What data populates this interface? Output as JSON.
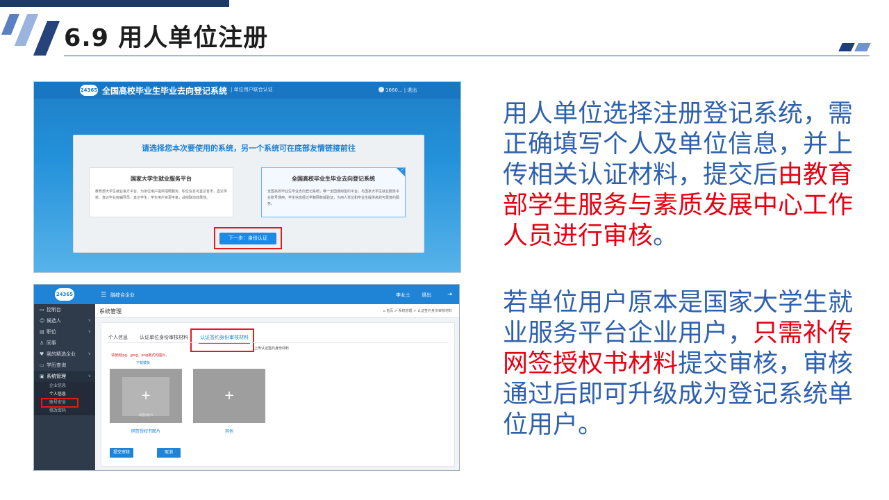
{
  "slide": {
    "title": "6.9 用人单位注册"
  },
  "screenshot1": {
    "logo": "24365",
    "system_name": "全国高校毕业生毕业去向登记系统",
    "header_sub": "| 单位用户联合认证",
    "user": "1660... | 退出",
    "prompt": "请选择您本次要使用的系统，另一个系统可在底部友情链接前往",
    "option1": {
      "title": "国家大学生就业服务平台",
      "desc": "教育部大学生就业官方平台，为单位用户提供招聘服务、职位信息可直达省市、直达学校、直达毕业班辅导员、直达学生，学生用户资源丰富，战线联动效果佳。"
    },
    "option2": {
      "title": "全国高校毕业生毕业去向登记系统",
      "desc": "全国高校毕业生毕业去向登记系统，唯一全国通用签约平台，与国家大学生就业服务平台账号通用，学生信息经过学籍网权威验证，为用人单位和毕业生提供高效可靠签约服务。",
      "check": "✓"
    },
    "next_button": "下一步：身份认证"
  },
  "screenshot2": {
    "logo": "24365",
    "menu_icon": "☰",
    "company": "融综合企业",
    "user": "李女士",
    "logout": "退出",
    "exit_icon": "⇥",
    "nav": [
      {
        "icon": "▭",
        "label": "控制台",
        "arrow": ""
      },
      {
        "icon": "☺",
        "label": "候选人",
        "arrow": "∨"
      },
      {
        "icon": "▤",
        "label": "职位",
        "arrow": "∨"
      },
      {
        "icon": "♙",
        "label": "同事",
        "arrow": ""
      },
      {
        "icon": "♥",
        "label": "我的精选企业",
        "arrow": "∨"
      },
      {
        "icon": "▭",
        "label": "学历查询",
        "arrow": ""
      },
      {
        "icon": "▣",
        "label": "系统管理",
        "arrow": "∨"
      }
    ],
    "subnav": [
      "企业信息",
      "个人信息",
      "账号安全",
      "修改密码"
    ],
    "page_title": "系统管理",
    "crumbs": "⌂ 首页 > 系统管理 > 认证签约身份审核材料",
    "tabs": [
      "个人信息",
      "认证单位身份审核材料",
      "认证签约身份审核材料"
    ],
    "upload_note": "上传认证签约身份材料",
    "warning": "请使用jpg、jpeg、png格式的图片。",
    "download": "下载模板",
    "box1_caption": "网签授权书图片",
    "box1_inner": "网签授权书",
    "box2_caption": "其他",
    "plus": "+",
    "submit": "提交审核",
    "cancel": "取消"
  },
  "text": {
    "p1_a": "用人单位选择注册登记系统，需正确填写个人及单位信息，并上传相关认证材料，提交后",
    "p1_red": "由教育部学生服务与素质发展中心工作人员进行审核",
    "p1_end": "。",
    "p2_a": "若单位用户原本是国家大学生就业服务平台企业用户，",
    "p2_red": "只需补传网签授权书材料",
    "p2_b": "提交审核，审核通过后即可升级成为登记系统单位用户。"
  },
  "colors": {
    "accent_blue": "#2e61ad",
    "highlight_red": "#e60012",
    "title_line": "#2f5597"
  }
}
